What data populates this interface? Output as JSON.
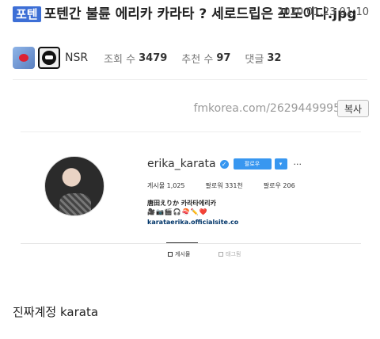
{
  "post": {
    "category": "포텐",
    "title": "포텐간 불륜 에리카 카라타 ? 세로드립은 포도이다.jpg",
    "date": "2020.01.23 01:10"
  },
  "meta": {
    "nickname": "NSR",
    "views_label": "조회 수",
    "views": "3479",
    "recommend_label": "추천 수",
    "recommend": "97",
    "comments_label": "댓글",
    "comments": "32"
  },
  "source": {
    "url": "fmkorea.com/2629449995",
    "copy_label": "복사"
  },
  "instagram": {
    "username": "erika_karata",
    "follow_label": "팔로우",
    "dropdown_label": "▾",
    "more_label": "···",
    "posts": "게시물 1,025",
    "followers": "팔로워 331천",
    "following": "팔로우 206",
    "bio_name": "唐田えりか 카라타에리카",
    "bio_emoji": "🎥📷🎬🎧🍣✏️❤️",
    "bio_link": "karataerika.officialsite.co",
    "tab_posts": "게시물",
    "tab_tagged": "태그됨"
  },
  "body": {
    "text": "진짜계정 karata"
  },
  "colors": {
    "category_badge": "#3d6fd6",
    "follow_button": "#3897f0"
  }
}
